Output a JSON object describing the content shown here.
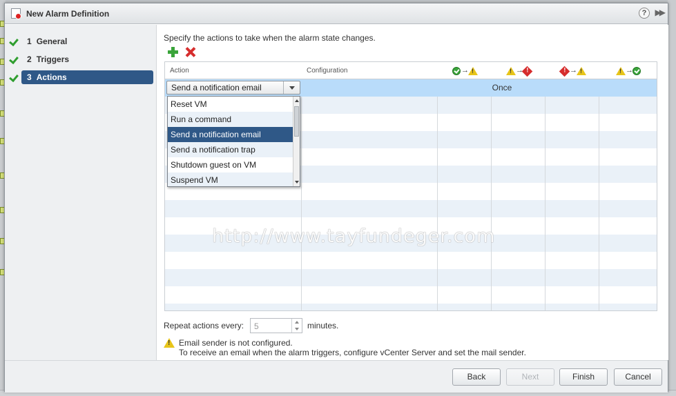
{
  "dialog": {
    "title": "New Alarm Definition"
  },
  "steps": [
    {
      "num": "1",
      "label": "General"
    },
    {
      "num": "2",
      "label": "Triggers"
    },
    {
      "num": "3",
      "label": "Actions"
    }
  ],
  "main": {
    "instruction": "Specify the actions to take when the alarm state changes.",
    "columns": {
      "action": "Action",
      "configuration": "Configuration"
    },
    "state_columns": [
      {
        "from": "ok-icon",
        "to": "warning-icon"
      },
      {
        "from": "warning-icon",
        "to": "critical-icon"
      },
      {
        "from": "critical-icon",
        "to": "warning-icon"
      },
      {
        "from": "warning-icon",
        "to": "ok-icon"
      }
    ],
    "selected_action": "Send a notification email",
    "frequency": "Once",
    "dropdown_options": [
      "Reset VM",
      "Run a command",
      "Send a notification email",
      "Send a notification trap",
      "Shutdown guest on VM",
      "Suspend VM"
    ],
    "repeat_label": "Repeat actions every:",
    "repeat_value": "5",
    "repeat_unit": "minutes.",
    "warning_line1": "Email sender is not configured.",
    "warning_line2": "To receive an email when the alarm triggers, configure vCenter Server and set the mail sender."
  },
  "watermark": "http://www.tayfundeger.com",
  "footer": {
    "back": "Back",
    "next": "Next",
    "finish": "Finish",
    "cancel": "Cancel"
  },
  "colors": {
    "selected_step": "#2f5887",
    "selected_row": "#b9dcfa",
    "alt_row": "#eaf1f8"
  }
}
